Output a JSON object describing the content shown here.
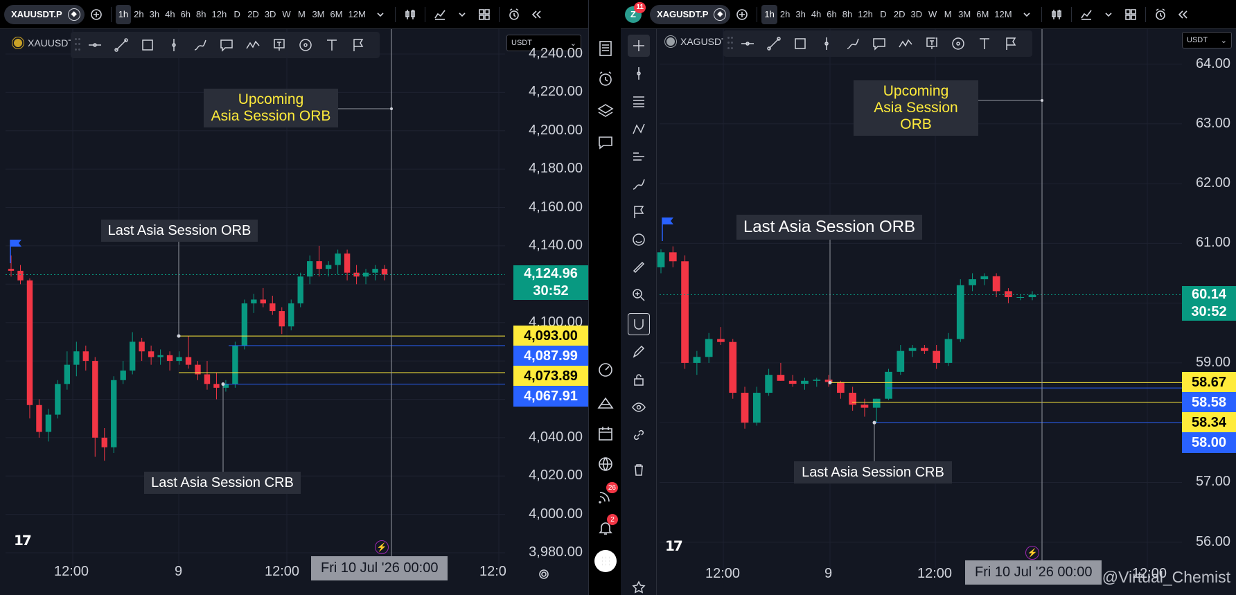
{
  "left": {
    "symbol": "XAUUSDT.P",
    "legend": "XAUUSDT",
    "currency": "USDT",
    "intervals": [
      "1h",
      "2h",
      "3h",
      "4h",
      "6h",
      "8h",
      "12h",
      "D",
      "2D",
      "3D",
      "W",
      "M",
      "3M",
      "6M",
      "12M"
    ],
    "active_interval": "1h",
    "yticks": [
      "4,240.00",
      "4,220.00",
      "4,200.00",
      "4,180.00",
      "4,160.00",
      "4,140.00",
      "4,100.00",
      "4,040.00",
      "4,020.00",
      "4,000.00",
      "3,980.00"
    ],
    "price_tags": {
      "last": "4,124.96",
      "countdown": "30:52",
      "orb_high": "4,093.00",
      "orb_low": "4,087.99",
      "crb_high": "4,073.89",
      "crb_low": "4,067.91"
    },
    "annotations": {
      "upcoming_line1": "Upcoming",
      "upcoming_line2": "Asia Session ORB",
      "last_orb": "Last Asia Session ORB",
      "last_crb": "Last Asia Session CRB"
    },
    "xaxis": {
      "t1": "12:00",
      "t2": "9",
      "t3": "12:00",
      "cross": "Fri 10 Jul '26   00:00",
      "t4": "12:0"
    }
  },
  "right": {
    "symbol": "XAGUSDT.P",
    "legend": "XAGUSDT",
    "currency": "USDT",
    "notif_count": "11",
    "avatar_letter": "Z",
    "intervals": [
      "1h",
      "2h",
      "3h",
      "4h",
      "6h",
      "8h",
      "12h",
      "D",
      "2D",
      "3D",
      "W",
      "M",
      "3M",
      "6M",
      "12M"
    ],
    "active_interval": "1h",
    "yticks": [
      "64.00",
      "63.00",
      "62.00",
      "61.00",
      "59.00",
      "57.00",
      "56.00"
    ],
    "price_tags": {
      "last": "60.14",
      "countdown": "30:52",
      "orb_high": "58.67",
      "orb_low": "58.58",
      "crb_high": "58.34",
      "crb_low": "58.00"
    },
    "annotations": {
      "upcoming_line1": "Upcoming",
      "upcoming_line2": "Asia Session ORB",
      "last_orb": "Last Asia Session ORB",
      "last_crb": "Last Asia Session CRB"
    },
    "xaxis": {
      "t1": "12:00",
      "t2": "9",
      "t3": "12:00",
      "cross": "Fri 10 Jul '26   00:00",
      "t4": "12:00"
    }
  },
  "sidebar": {
    "ideas_badge": "26",
    "alerts_badge": "2"
  },
  "watermark": "@Virtual_Chemist",
  "chart_data": [
    {
      "type": "candlestick",
      "series": [
        {
          "name": "XAUUSDT",
          "ohlc": [
            [
              4128,
              4135,
              4124,
              4127
            ],
            [
              4127,
              4130,
              4120,
              4122
            ],
            [
              4122,
              4123,
              4050,
              4057
            ],
            [
              4057,
              4060,
              4040,
              4043
            ],
            [
              4043,
              4055,
              4038,
              4052
            ],
            [
              4052,
              4070,
              4050,
              4068
            ],
            [
              4068,
              4085,
              4065,
              4078
            ],
            [
              4078,
              4090,
              4072,
              4085
            ],
            [
              4085,
              4088,
              4075,
              4080
            ],
            [
              4080,
              4082,
              4030,
              4040
            ],
            [
              4040,
              4045,
              4028,
              4035
            ],
            [
              4035,
              4072,
              4032,
              4070
            ],
            [
              4070,
              4080,
              4068,
              4075
            ],
            [
              4075,
              4095,
              4073,
              4090
            ],
            [
              4090,
              4092,
              4080,
              4085
            ],
            [
              4085,
              4088,
              4078,
              4082
            ],
            [
              4082,
              4086,
              4078,
              4083
            ],
            [
              4083,
              4085,
              4075,
              4080
            ],
            [
              4080,
              4085,
              4078,
              4082
            ],
            [
              4082,
              4093,
              4076,
              4078
            ],
            [
              4078,
              4080,
              4070,
              4073
            ],
            [
              4073,
              4080,
              4065,
              4068
            ],
            [
              4068,
              4074,
              4060,
              4066
            ],
            [
              4066,
              4070,
              4064,
              4068
            ],
            [
              4068,
              4090,
              4066,
              4088
            ],
            [
              4088,
              4112,
              4086,
              4110
            ],
            [
              4110,
              4115,
              4105,
              4112
            ],
            [
              4112,
              4118,
              4108,
              4110
            ],
            [
              4110,
              4114,
              4104,
              4106
            ],
            [
              4106,
              4108,
              4094,
              4098
            ],
            [
              4098,
              4112,
              4096,
              4110
            ],
            [
              4110,
              4126,
              4108,
              4124
            ],
            [
              4124,
              4135,
              4120,
              4132
            ],
            [
              4132,
              4140,
              4124,
              4128
            ],
            [
              4128,
              4132,
              4124,
              4130
            ],
            [
              4130,
              4138,
              4125,
              4136
            ],
            [
              4136,
              4138,
              4122,
              4126
            ],
            [
              4126,
              4130,
              4120,
              4124
            ],
            [
              4124,
              4128,
              4120,
              4126
            ],
            [
              4126,
              4130,
              4122,
              4128
            ],
            [
              4128,
              4130,
              4122,
              4125
            ]
          ]
        }
      ],
      "levels": {
        "orb_high": 4093.0,
        "orb_low": 4087.99,
        "crb_high": 4073.89,
        "crb_low": 4067.91
      },
      "ylim": [
        3980,
        4240
      ]
    },
    {
      "type": "candlestick",
      "series": [
        {
          "name": "XAGUSDT",
          "ohlc": [
            [
              60.6,
              60.9,
              60.5,
              60.85
            ],
            [
              60.85,
              60.95,
              60.6,
              60.7
            ],
            [
              60.7,
              60.8,
              58.9,
              59.0
            ],
            [
              59.0,
              59.2,
              58.8,
              59.1
            ],
            [
              59.1,
              59.5,
              59.0,
              59.4
            ],
            [
              59.4,
              59.6,
              59.3,
              59.35
            ],
            [
              59.35,
              59.4,
              58.4,
              58.5
            ],
            [
              58.5,
              58.6,
              57.9,
              58.0
            ],
            [
              58.0,
              58.6,
              57.95,
              58.5
            ],
            [
              58.5,
              58.9,
              58.45,
              58.8
            ],
            [
              58.8,
              59.0,
              58.7,
              58.7
            ],
            [
              58.7,
              58.8,
              58.6,
              58.65
            ],
            [
              58.65,
              58.75,
              58.55,
              58.7
            ],
            [
              58.7,
              58.75,
              58.6,
              58.72
            ],
            [
              58.72,
              58.8,
              58.6,
              58.68
            ],
            [
              58.68,
              58.7,
              58.4,
              58.5
            ],
            [
              58.5,
              58.6,
              58.2,
              58.3
            ],
            [
              58.3,
              58.4,
              58.1,
              58.25
            ],
            [
              58.25,
              58.4,
              58.0,
              58.4
            ],
            [
              58.4,
              58.9,
              58.38,
              58.85
            ],
            [
              58.85,
              59.3,
              58.8,
              59.2
            ],
            [
              59.2,
              59.3,
              59.1,
              59.25
            ],
            [
              59.25,
              59.3,
              59.15,
              59.2
            ],
            [
              59.2,
              59.3,
              58.9,
              59.0
            ],
            [
              59.0,
              59.5,
              58.95,
              59.4
            ],
            [
              59.4,
              60.4,
              59.35,
              60.3
            ],
            [
              60.3,
              60.5,
              60.2,
              60.4
            ],
            [
              60.4,
              60.5,
              60.3,
              60.45
            ],
            [
              60.45,
              60.5,
              60.1,
              60.2
            ],
            [
              60.2,
              60.25,
              60.0,
              60.1
            ],
            [
              60.1,
              60.15,
              60.05,
              60.1
            ],
            [
              60.1,
              60.2,
              60.05,
              60.14
            ]
          ]
        }
      ],
      "levels": {
        "orb_high": 58.67,
        "orb_low": 58.58,
        "crb_high": 58.34,
        "crb_low": 58.0
      },
      "ylim": [
        55.8,
        64.4
      ]
    }
  ]
}
